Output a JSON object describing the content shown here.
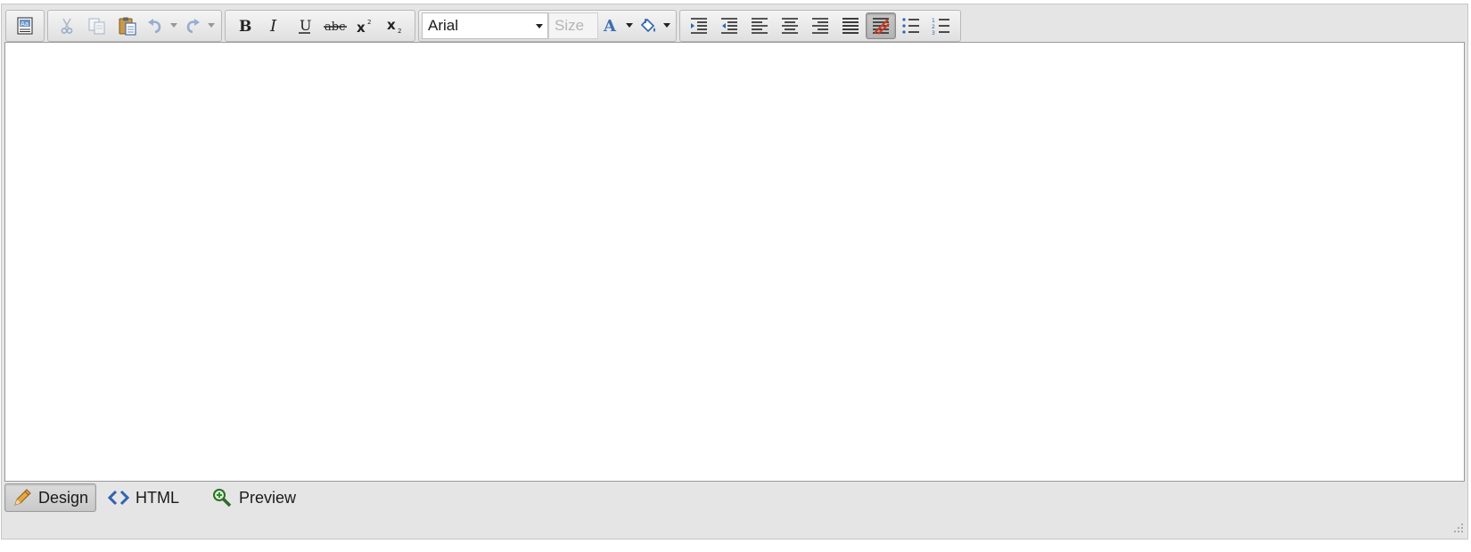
{
  "toolbar": {
    "font_name": "Arial",
    "font_size_placeholder": "Size",
    "groups": [
      [
        "module-icon"
      ],
      [
        "cut-icon",
        "copy-icon",
        "paste-icon",
        "undo-icon",
        "redo-icon"
      ],
      [
        "bold-icon",
        "italic-icon",
        "underline-icon",
        "strikethrough-icon",
        "superscript-icon",
        "subscript-icon"
      ],
      [
        "font-select",
        "size-select",
        "font-color-icon",
        "highlight-color-icon"
      ],
      [
        "indent-icon",
        "outdent-icon",
        "align-left-icon",
        "align-center-icon",
        "align-right-icon",
        "justify-icon",
        "clear-formatting-icon",
        "bullet-list-icon",
        "numbered-list-icon"
      ]
    ],
    "accent_color": "#3b6fb6"
  },
  "modes": [
    {
      "label": "Design",
      "icon": "pencil-icon",
      "active": true
    },
    {
      "label": "HTML",
      "icon": "code-icon",
      "active": false
    },
    {
      "label": "Preview",
      "icon": "magnifier-icon",
      "active": false
    }
  ]
}
